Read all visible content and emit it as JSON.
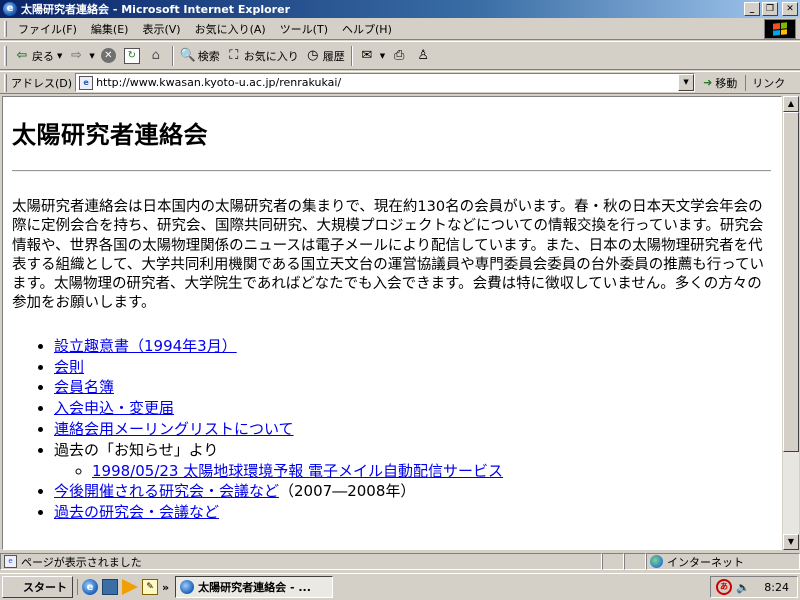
{
  "window": {
    "title": "太陽研究者連絡会 - Microsoft Internet Explorer"
  },
  "menu": [
    "ファイル(F)",
    "編集(E)",
    "表示(V)",
    "お気に入り(A)",
    "ツール(T)",
    "ヘルプ(H)"
  ],
  "toolbar": {
    "back": "戻る",
    "search": "検索",
    "favorites": "お気に入り",
    "history": "履歴"
  },
  "address": {
    "label": "アドレス(D)",
    "url": "http://www.kwasan.kyoto-u.ac.jp/renrakukai/",
    "go": "移動",
    "links": "リンク"
  },
  "page": {
    "heading": "太陽研究者連絡会",
    "intro": "太陽研究者連絡会は日本国内の太陽研究者の集まりで、現在約130名の会員がいます。春・秋の日本天文学会年会の際に定例会合を持ち、研究会、国際共同研究、大規模プロジェクトなどについての情報交換を行っています。研究会情報や、世界各国の太陽物理関係のニュースは電子メールにより配信しています。また、日本の太陽物理研究者を代表する組織として、大学共同利用機関である国立天文台の運営協議員や専門委員会委員の台外委員の推薦も行っています。太陽物理の研究者、大学院生であればどなたでも入会できます。会費は特に徴収していません。多くの方々の参加をお願いします。",
    "links": {
      "prospectus": "設立趣意書（1994年3月）",
      "rules": "会則",
      "roster": "会員名簿",
      "application": "入会申込・変更届",
      "mailing_list": "連絡会用メーリングリストについて",
      "past_news_label": "過去の「お知らせ」より",
      "past_news_item": "1998/05/23 太陽地球環境予報 電子メイル自動配信サービス",
      "upcoming": "今後開催される研究会・会議など",
      "upcoming_note": "（2007―2008年）",
      "past_meetings": "過去の研究会・会議など"
    }
  },
  "status": {
    "text": "ページが表示されました",
    "zone": "インターネット"
  },
  "taskbar": {
    "start": "スタート",
    "task": "太陽研究者連絡会 - ...",
    "more": "»",
    "clock": "8:24"
  }
}
